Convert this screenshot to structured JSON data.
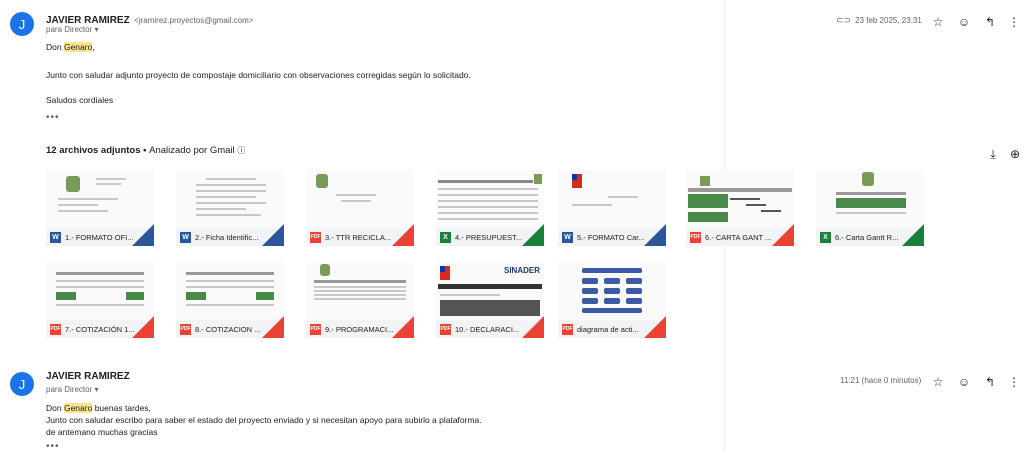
{
  "message1": {
    "avatar_letter": "J",
    "sender": "JAVIER RAMIREZ",
    "email": "<jramirez.proyectos@gmail.com>",
    "to": "para Director",
    "date": "23 feb 2025, 23:31",
    "greeting_prefix": "Don ",
    "greeting_name": "Genaro",
    "greeting_suffix": ",",
    "body1": "Junto con saludar adjunto proyecto de compostaje domiciliario con observaciones corregidas según lo solicitado.",
    "body2": "Saludos cordiales",
    "ellipsis": "•••"
  },
  "attachments": {
    "title": "12 archivos adjuntos",
    "separator": " • ",
    "scan_text": "Analizado por Gmail",
    "files": [
      {
        "name": "1.- FORMATO OFI...",
        "type": "W",
        "color": "#2b579a"
      },
      {
        "name": "2.- Ficha Identific...",
        "type": "W",
        "color": "#2b579a"
      },
      {
        "name": "3.- TTR RECICLA...",
        "type": "PDF",
        "color": "#ea4335"
      },
      {
        "name": "4.- PRESUPUEST...",
        "type": "X",
        "color": "#188038"
      },
      {
        "name": "5.- FORMATO Car...",
        "type": "W",
        "color": "#2b579a"
      },
      {
        "name": "6.- CARTA GANT ...",
        "type": "PDF",
        "color": "#ea4335"
      },
      {
        "name": "6.- Carta Gantt R...",
        "type": "X",
        "color": "#188038"
      },
      {
        "name": "7.- COTIZACIÓN 1...",
        "type": "PDF",
        "color": "#ea4335"
      },
      {
        "name": "8.- COTIZACION ...",
        "type": "PDF",
        "color": "#ea4335"
      },
      {
        "name": "9.- PROGRAMACI...",
        "type": "PDF",
        "color": "#ea4335"
      },
      {
        "name": "10.- DECLARACI...",
        "type": "PDF",
        "color": "#ea4335"
      },
      {
        "name": "diagrama de acti...",
        "type": "PDF",
        "color": "#ea4335"
      }
    ]
  },
  "message2": {
    "avatar_letter": "J",
    "sender": "JAVIER RAMIREZ",
    "to": "para Director",
    "date": "11:21 (hace 0 minutos)",
    "greeting_prefix": "Don ",
    "greeting_name": "Genaro",
    "greeting_suffix": " buenas tardes,",
    "body1": "Junto con saludar escribo para saber el estado del proyecto enviado y si necesitan apoyo para subirlo a plataforma.",
    "body2": "de antemano muchas gracias",
    "ellipsis": "•••"
  },
  "thumb_text": {
    "sinader": "SINADER"
  },
  "colors": {
    "avatar": "#1a73e8",
    "highlight": "#fbe58a"
  }
}
